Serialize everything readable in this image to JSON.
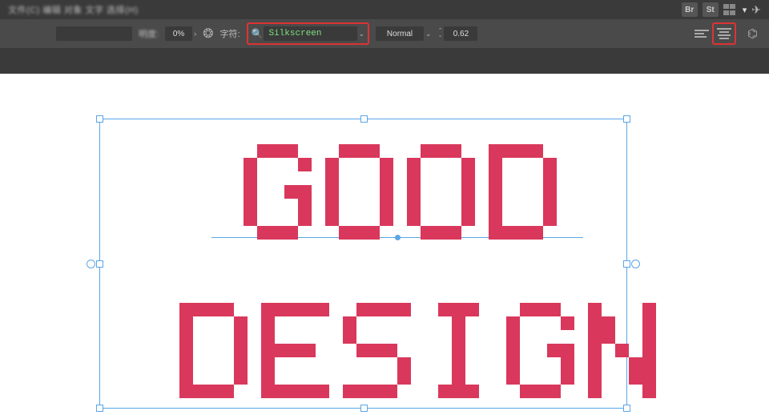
{
  "menubar": {
    "menu_blur": "文件(C)   编辑   对象   文字   选择(H)",
    "br_label": "Br",
    "st_label": "St"
  },
  "optbar": {
    "opacity_label": "明度:",
    "opacity_value": "0%",
    "char_label": "字符:",
    "font_name": "Silkscreen",
    "style_value": "Normal",
    "tracking_value": "0.62"
  },
  "canvas": {
    "line1": "GOOD",
    "line2": "DESIGN"
  }
}
